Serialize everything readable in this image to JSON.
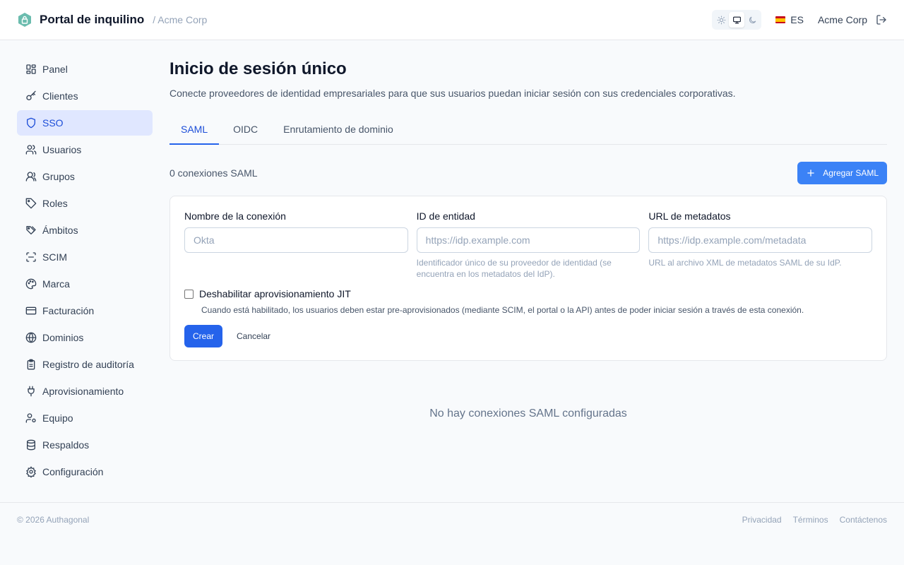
{
  "header": {
    "title": "Portal de inquilino",
    "tenant": "/ Acme Corp",
    "language": "ES",
    "org": "Acme Corp",
    "theme_modes": [
      "sun-icon",
      "monitor-icon",
      "moon-icon"
    ],
    "active_theme": "system"
  },
  "sidebar": {
    "items": [
      {
        "label": "Panel",
        "icon": "dashboard-icon"
      },
      {
        "label": "Clientes",
        "icon": "key-icon"
      },
      {
        "label": "SSO",
        "icon": "shield-icon",
        "active": true
      },
      {
        "label": "Usuarios",
        "icon": "users-icon"
      },
      {
        "label": "Grupos",
        "icon": "group-icon"
      },
      {
        "label": "Roles",
        "icon": "tag-icon"
      },
      {
        "label": "Ámbitos",
        "icon": "tags-icon"
      },
      {
        "label": "SCIM",
        "icon": "scan-icon"
      },
      {
        "label": "Marca",
        "icon": "palette-icon"
      },
      {
        "label": "Facturación",
        "icon": "credit-card-icon"
      },
      {
        "label": "Dominios",
        "icon": "globe-icon"
      },
      {
        "label": "Registro de auditoría",
        "icon": "clipboard-icon"
      },
      {
        "label": "Aprovisionamiento",
        "icon": "plug-icon"
      },
      {
        "label": "Equipo",
        "icon": "user-cog-icon"
      },
      {
        "label": "Respaldos",
        "icon": "database-icon"
      },
      {
        "label": "Configuración",
        "icon": "gear-icon"
      }
    ]
  },
  "main": {
    "title": "Inicio de sesión único",
    "description": "Conecte proveedores de identidad empresariales para que sus usuarios puedan iniciar sesión con sus credenciales corporativas.",
    "tabs": [
      {
        "label": "SAML",
        "active": true
      },
      {
        "label": "OIDC"
      },
      {
        "label": "Enrutamiento de dominio"
      }
    ],
    "count_label": "0 conexiones SAML",
    "add_button": "Agregar SAML",
    "form": {
      "name_label": "Nombre de la conexión",
      "name_placeholder": "Okta",
      "entity_label": "ID de entidad",
      "entity_placeholder": "https://idp.example.com",
      "entity_hint": "Identificador único de su proveedor de identidad (se encuentra en los metadatos del IdP).",
      "metadata_label": "URL de metadatos",
      "metadata_placeholder": "https://idp.example.com/metadata",
      "metadata_hint": "URL al archivo XML de metadatos SAML de su IdP.",
      "jit_label": "Deshabilitar aprovisionamiento JIT",
      "jit_checked": false,
      "jit_help": "Cuando está habilitado, los usuarios deben estar pre-aprovisionados (mediante SCIM, el portal o la API) antes de poder iniciar sesión a través de esta conexión.",
      "create_button": "Crear",
      "cancel_button": "Cancelar"
    },
    "empty_state": "No hay conexiones SAML configuradas"
  },
  "footer": {
    "copyright": "© 2026 Authagonal",
    "links": [
      "Privacidad",
      "Términos",
      "Contáctenos"
    ]
  },
  "colors": {
    "accent": "#2563eb",
    "active_nav_bg": "#e0e7ff",
    "brand_logo": "#5fb3a6"
  }
}
